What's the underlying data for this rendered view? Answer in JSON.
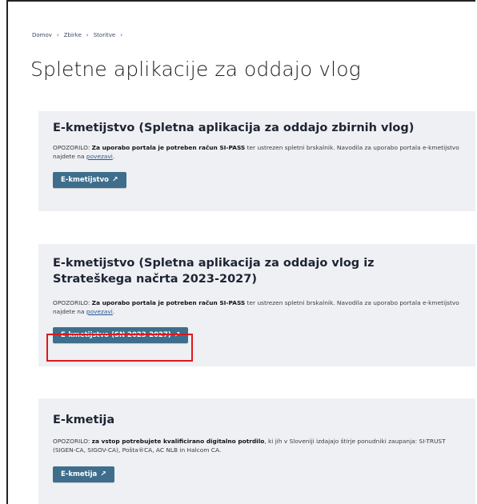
{
  "breadcrumb": [
    "Domov",
    "Zbirke",
    "Storitve"
  ],
  "breadcrumb_separator": "›",
  "page_title": "Spletne aplikacije za oddajo vlog",
  "cards": [
    {
      "title": "E-kmetijstvo (Spletna aplikacija za oddajo zbirnih vlog)",
      "text_prefix": "OPOZORILO: ",
      "text_bold": "Za uporabo portala je potreben račun SI-PASS",
      "text_rest": " ter ustrezen spletni brskalnik. Navodila za uporabo portala e-kmetijstvo najdete na ",
      "link": "povezavi",
      "text_end": ".",
      "button": "E-kmetijstvo",
      "button_icon": "↗"
    },
    {
      "title": "E-kmetijstvo (Spletna aplikacija za oddajo vlog iz Strateškega načrta 2023-2027)",
      "text_prefix": "OPOZORILO: ",
      "text_bold": "Za uporabo portala je potreben račun SI-PASS",
      "text_rest": " ter ustrezen spletni brskalnik. Navodila za uporabo portala e-kmetijstvo najdete na ",
      "link": "povezavi",
      "text_end": ".",
      "button": "E-kmetijstvo (SN 2023-2027)",
      "button_icon": "↗"
    },
    {
      "title": "E-kmetija",
      "text_prefix": "OPOZORILO: ",
      "text_bold": "za vstop potrebujete kvalificirano digitalno potrdilo",
      "text_rest": ", ki jih v Sloveniji izdajajo štirje ponudniki zaupanja: SI-TRUST (SIGEN-CA, SIGOV-CA), Pošta®CA, AC NLB in Halcom CA.",
      "link": "",
      "text_end": "",
      "button": "E-kmetija",
      "button_icon": "↗"
    }
  ],
  "colors": {
    "button_bg": "#3e6e8c",
    "card_bg": "#eef0f3",
    "highlight": "#e0181d"
  }
}
